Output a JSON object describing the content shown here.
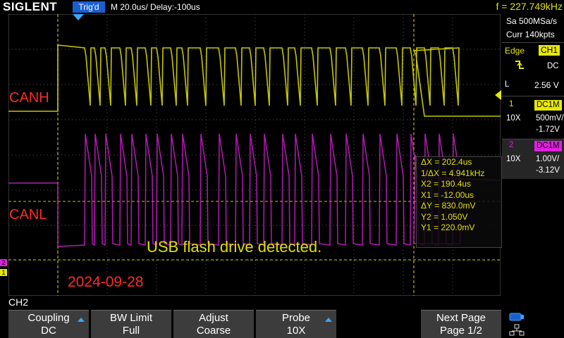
{
  "header": {
    "logo": "SIGLENT",
    "trigger_status": "Trig'd",
    "timebase_delay": "M 20.0us/  Delay:-100us",
    "frequency": "f = 227.749kHz"
  },
  "acquisition": {
    "sample_rate": "Sa 500MSa/s",
    "memory": "Curr 140kpts"
  },
  "trigger": {
    "type_label": "Edge",
    "source": "CH1",
    "coupling": "DC",
    "level_label": "L",
    "level": "2.56 V"
  },
  "channels": [
    {
      "num": "1",
      "coupling": "DC1M",
      "probe": "10X",
      "scale": "500mV/",
      "offset": "-1.72V",
      "color": "#e8e800"
    },
    {
      "num": "2",
      "coupling": "DC1M",
      "probe": "10X",
      "scale": "1.00V/",
      "offset": "-3.12V",
      "color": "#e020e0"
    }
  ],
  "cursors": {
    "dx": "ΔX = 202.4us",
    "inv_dx": "1/ΔX = 4.941kHz",
    "x2": "X2 = 190.4us",
    "x1": "X1 = -12.00us",
    "dy": "ΔY = 830.0mV",
    "y2": "Y2 = 1.050V",
    "y1": "Y1 = 220.0mV"
  },
  "annotations": {
    "canh": "CANH",
    "canl": "CANL",
    "usb_message": "USB flash drive detected.",
    "date": "2024-09-28"
  },
  "menu": {
    "title": "CH2",
    "softkeys": [
      {
        "label": "Coupling",
        "value": "DC"
      },
      {
        "label": "BW Limit",
        "value": "Full"
      },
      {
        "label": "Adjust",
        "value": "Coarse"
      },
      {
        "label": "Probe",
        "value": "10X"
      },
      {
        "label": "Next Page",
        "value": "Page 1/2"
      }
    ]
  },
  "markers": {
    "ch1_ground": "1",
    "ch2_ground": "2"
  }
}
